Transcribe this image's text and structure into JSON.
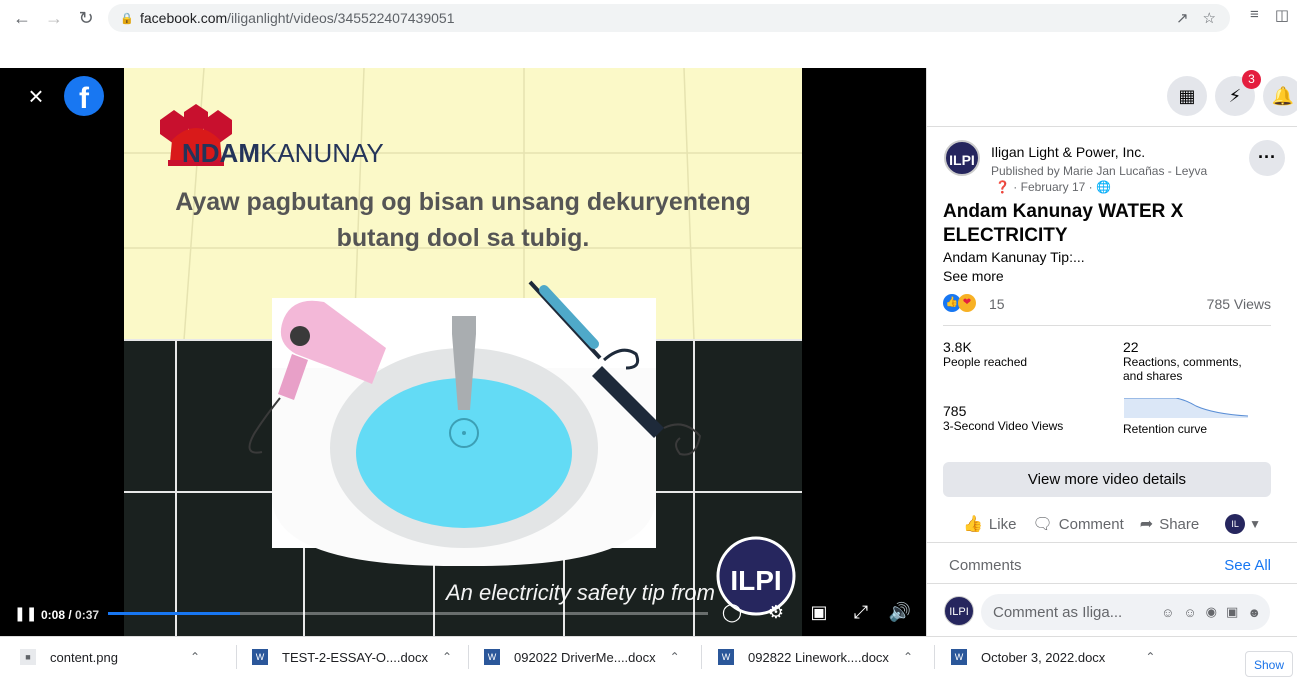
{
  "browser": {
    "url_host": "facebook.com",
    "url_path": "/iliganlight/videos/345522407439051"
  },
  "video": {
    "brand_prefix": "NDAM",
    "brand_suffix": "KANUNAY",
    "headline_line1": "Ayaw pagbutang og bisan unsang dekuryenteng",
    "headline_line2": "butang dool sa tubig.",
    "caption": "An electricity safety tip from",
    "time_current": "0:08",
    "time_total": "0:37",
    "progress_fraction": 0.22
  },
  "panel": {
    "messenger_badge": "3",
    "page_name": "Iligan Light & Power, Inc.",
    "published_by": "Published by Marie Jan Lucañas - Leyva",
    "date": "February 17",
    "title": "Andam Kanunay WATER X ELECTRICITY",
    "description": "Andam Kanunay Tip:...",
    "see_more": "See more",
    "reaction_count": "15",
    "views": "785 Views",
    "stats": [
      {
        "value": "3.8K",
        "label": "People reached"
      },
      {
        "value": "22",
        "label": "Reactions, comments, and shares"
      },
      {
        "value": "785",
        "label": "3-Second Video Views"
      },
      {
        "value": "",
        "label": "Retention curve"
      }
    ],
    "view_more_button": "View more video details",
    "actions": {
      "like": "Like",
      "comment": "Comment",
      "share": "Share"
    },
    "comments_heading": "Comments",
    "see_all": "See All",
    "comment_placeholder": "Comment as Iliga..."
  },
  "downloads": [
    {
      "name": "content.png",
      "type": "png"
    },
    {
      "name": "TEST-2-ESSAY-O....docx",
      "type": "docx"
    },
    {
      "name": "092022 DriverMe....docx",
      "type": "docx"
    },
    {
      "name": "092822 Linework....docx",
      "type": "docx"
    },
    {
      "name": "October 3, 2022.docx",
      "type": "docx"
    }
  ],
  "show_all": "Show"
}
